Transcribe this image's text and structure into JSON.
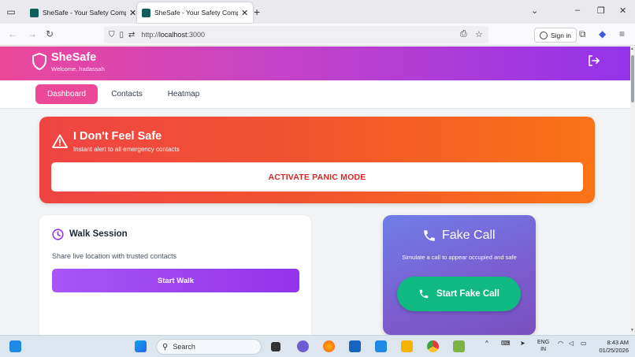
{
  "browser": {
    "tabs": [
      {
        "title": "SheSafe - Your Safety Companion",
        "active": false
      },
      {
        "title": "SheSafe - Your Safety Companion",
        "active": true
      }
    ],
    "url_prefix": "http://",
    "url_host": "localhost",
    "url_port": ":3000",
    "sign_in_label": "Sign in"
  },
  "app": {
    "brand": "SheSafe",
    "welcome": "Welcome, hadassah",
    "colors": {
      "header_start": "#ec4899",
      "header_end": "#9333ea",
      "panic_start": "#ef4444",
      "panic_end": "#f97316",
      "fake_call_btn": "#10b981"
    }
  },
  "nav": {
    "tabs": [
      {
        "label": "Dashboard",
        "active": true
      },
      {
        "label": "Contacts",
        "active": false
      },
      {
        "label": "Heatmap",
        "active": false
      }
    ]
  },
  "panic": {
    "title": "I Don't Feel Safe",
    "subtitle": "Instant alert to all emergency contacts",
    "button": "ACTIVATE PANIC MODE",
    "icon": "warning-triangle-icon"
  },
  "walk": {
    "title": "Walk Session",
    "description": "Share live location with trusted contacts",
    "button": "Start Walk",
    "icon": "clock-icon"
  },
  "fake_call": {
    "title": "Fake Call",
    "description": "Simulate a call to appear occupied and safe",
    "button": "Start Fake Call",
    "icon": "phone-icon"
  },
  "taskbar": {
    "search_placeholder": "Search",
    "lang_line1": "ENG",
    "lang_line2": "IN",
    "time": "8:43 AM",
    "date": "01/25/2026"
  }
}
